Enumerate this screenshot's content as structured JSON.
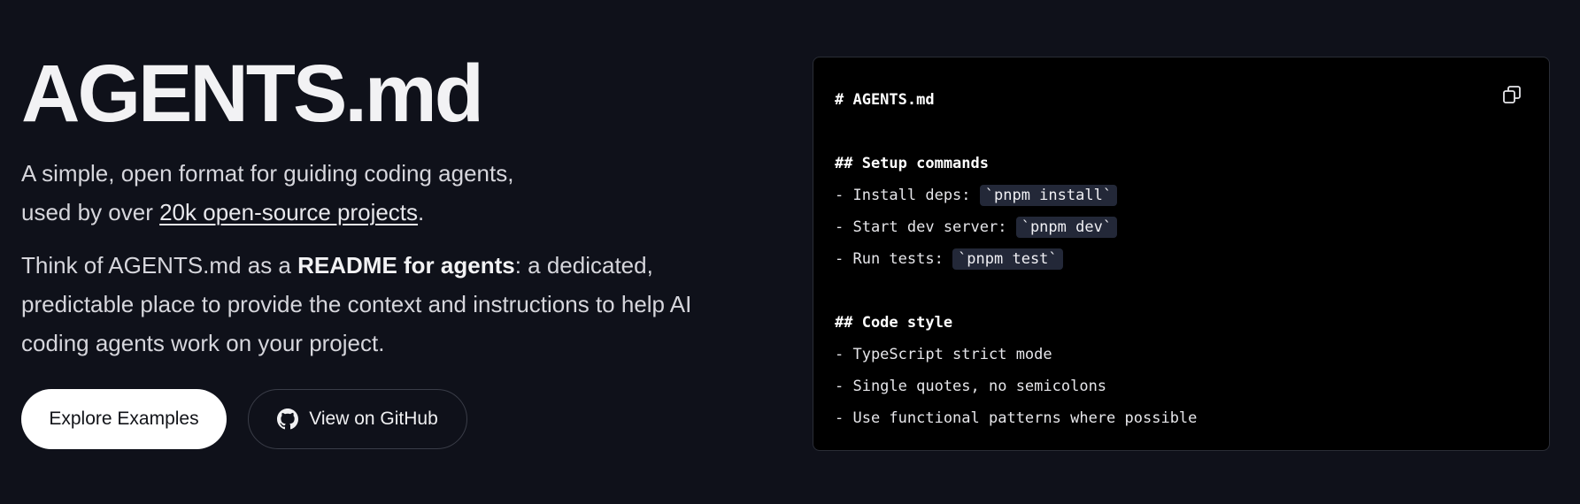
{
  "hero": {
    "title": "AGENTS.md",
    "tagline_line1": "A simple, open format for guiding coding agents,",
    "tagline_prefix": "used by over ",
    "tagline_link": "20k open-source projects",
    "tagline_suffix": ".",
    "desc_prefix": "Think of AGENTS.md as a ",
    "desc_bold": "README for agents",
    "desc_suffix": ": a dedicated, predictable place to provide the context and instructions to help AI coding agents work on your project."
  },
  "buttons": {
    "explore_label": "Explore Examples",
    "github_label": "View on GitHub",
    "github_icon": "github-icon"
  },
  "code_panel": {
    "copy_icon": "copy-icon",
    "heading": "# AGENTS.md",
    "setup_heading": "## Setup commands",
    "setup_items": [
      {
        "prefix": "- Install deps: ",
        "code": "`pnpm install`"
      },
      {
        "prefix": "- Start dev server: ",
        "code": "`pnpm dev`"
      },
      {
        "prefix": "- Run tests: ",
        "code": "`pnpm test`"
      }
    ],
    "style_heading": "## Code style",
    "style_items": [
      "- TypeScript strict mode",
      "- Single quotes, no semicolons",
      "- Use functional patterns where possible"
    ]
  },
  "colors": {
    "background": "#0f111a",
    "panel": "#000000",
    "inline_code_bg": "#232838",
    "primary_button": "#ffffff"
  }
}
